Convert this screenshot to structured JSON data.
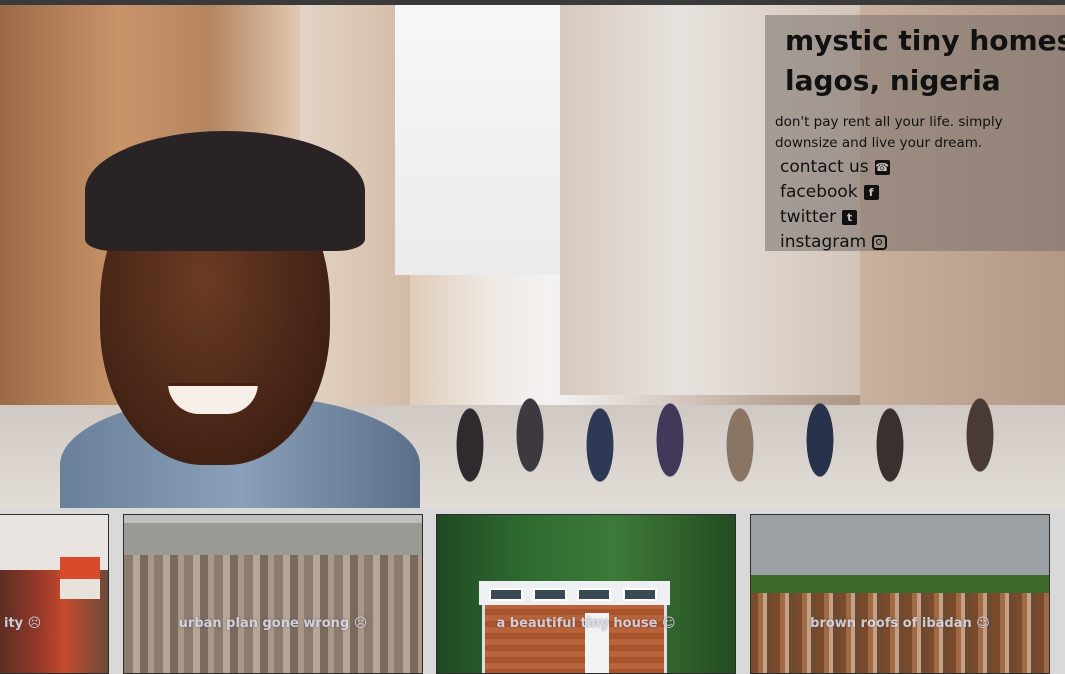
{
  "site": {
    "title_line1": "mystic tiny homes,",
    "title_line2": "lagos, nigeria",
    "tagline": "don't pay rent all your life. simply downsize and live your dream."
  },
  "links": [
    {
      "label": "contact us",
      "icon": "contact-icon",
      "glyph": "☎"
    },
    {
      "label": "facebook",
      "icon": "facebook-icon",
      "glyph": "f"
    },
    {
      "label": "twitter",
      "icon": "twitter-icon",
      "glyph": "t"
    },
    {
      "label": "instagram",
      "icon": "instagram-icon",
      "glyph": ""
    }
  ],
  "gallery": [
    {
      "caption": "ity ☹"
    },
    {
      "caption": "urban plan gone wrong ☹"
    },
    {
      "caption": "a beautiful tiny house ☺"
    },
    {
      "caption": "brown roofs of ibadan ☺"
    }
  ],
  "colors": {
    "panel_bg": "#78706c",
    "text": "#111111",
    "caption": "#e6e2f0"
  }
}
